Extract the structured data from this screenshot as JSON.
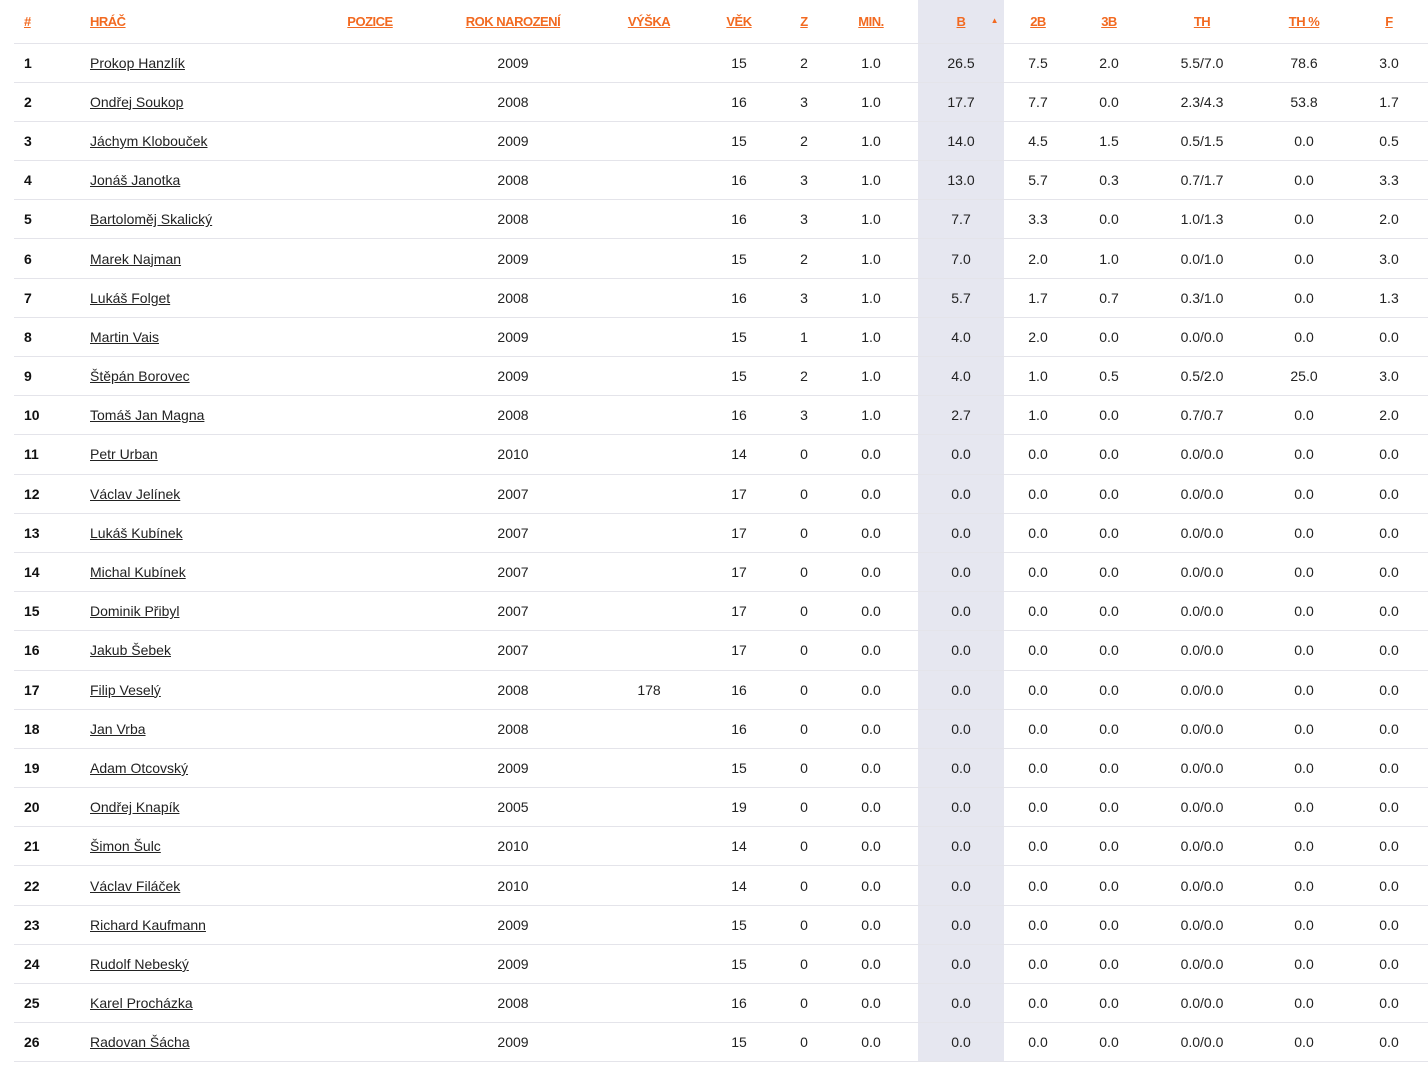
{
  "table": {
    "headers": {
      "rank": "#",
      "player": "HRÁČ",
      "position": "POZICE",
      "birth_year": "ROK NAROZENÍ",
      "height": "VÝŠKA",
      "age": "VĚK",
      "games": "Z",
      "minutes": "MIN.",
      "points": "B",
      "two_pt": "2B",
      "three_pt": "3B",
      "free_throws": "TH",
      "free_throw_pct": "TH %",
      "fouls": "F"
    },
    "sort_indicator": "▲",
    "rows": [
      {
        "rank": "1",
        "name": "Prokop Hanzlík",
        "position": "",
        "birth_year": "2009",
        "height": "",
        "age": "15",
        "games": "2",
        "minutes": "1.0",
        "points": "26.5",
        "two_pt": "7.5",
        "three_pt": "2.0",
        "free_throws": "5.5/7.0",
        "ft_pct": "78.6",
        "fouls": "3.0"
      },
      {
        "rank": "2",
        "name": "Ondřej Soukop",
        "position": "",
        "birth_year": "2008",
        "height": "",
        "age": "16",
        "games": "3",
        "minutes": "1.0",
        "points": "17.7",
        "two_pt": "7.7",
        "three_pt": "0.0",
        "free_throws": "2.3/4.3",
        "ft_pct": "53.8",
        "fouls": "1.7"
      },
      {
        "rank": "3",
        "name": "Jáchym Klobouček",
        "position": "",
        "birth_year": "2009",
        "height": "",
        "age": "15",
        "games": "2",
        "minutes": "1.0",
        "points": "14.0",
        "two_pt": "4.5",
        "three_pt": "1.5",
        "free_throws": "0.5/1.5",
        "ft_pct": "0.0",
        "fouls": "0.5"
      },
      {
        "rank": "4",
        "name": "Jonáš Janotka",
        "position": "",
        "birth_year": "2008",
        "height": "",
        "age": "16",
        "games": "3",
        "minutes": "1.0",
        "points": "13.0",
        "two_pt": "5.7",
        "three_pt": "0.3",
        "free_throws": "0.7/1.7",
        "ft_pct": "0.0",
        "fouls": "3.3"
      },
      {
        "rank": "5",
        "name": "Bartoloměj Skalický",
        "position": "",
        "birth_year": "2008",
        "height": "",
        "age": "16",
        "games": "3",
        "minutes": "1.0",
        "points": "7.7",
        "two_pt": "3.3",
        "three_pt": "0.0",
        "free_throws": "1.0/1.3",
        "ft_pct": "0.0",
        "fouls": "2.0"
      },
      {
        "rank": "6",
        "name": "Marek Najman",
        "position": "",
        "birth_year": "2009",
        "height": "",
        "age": "15",
        "games": "2",
        "minutes": "1.0",
        "points": "7.0",
        "two_pt": "2.0",
        "three_pt": "1.0",
        "free_throws": "0.0/1.0",
        "ft_pct": "0.0",
        "fouls": "3.0"
      },
      {
        "rank": "7",
        "name": "Lukáš Folget",
        "position": "",
        "birth_year": "2008",
        "height": "",
        "age": "16",
        "games": "3",
        "minutes": "1.0",
        "points": "5.7",
        "two_pt": "1.7",
        "three_pt": "0.7",
        "free_throws": "0.3/1.0",
        "ft_pct": "0.0",
        "fouls": "1.3"
      },
      {
        "rank": "8",
        "name": "Martin Vais",
        "position": "",
        "birth_year": "2009",
        "height": "",
        "age": "15",
        "games": "1",
        "minutes": "1.0",
        "points": "4.0",
        "two_pt": "2.0",
        "three_pt": "0.0",
        "free_throws": "0.0/0.0",
        "ft_pct": "0.0",
        "fouls": "0.0"
      },
      {
        "rank": "9",
        "name": "Štěpán Borovec",
        "position": "",
        "birth_year": "2009",
        "height": "",
        "age": "15",
        "games": "2",
        "minutes": "1.0",
        "points": "4.0",
        "two_pt": "1.0",
        "three_pt": "0.5",
        "free_throws": "0.5/2.0",
        "ft_pct": "25.0",
        "fouls": "3.0"
      },
      {
        "rank": "10",
        "name": "Tomáš Jan Magna",
        "position": "",
        "birth_year": "2008",
        "height": "",
        "age": "16",
        "games": "3",
        "minutes": "1.0",
        "points": "2.7",
        "two_pt": "1.0",
        "three_pt": "0.0",
        "free_throws": "0.7/0.7",
        "ft_pct": "0.0",
        "fouls": "2.0"
      },
      {
        "rank": "11",
        "name": "Petr Urban",
        "position": "",
        "birth_year": "2010",
        "height": "",
        "age": "14",
        "games": "0",
        "minutes": "0.0",
        "points": "0.0",
        "two_pt": "0.0",
        "three_pt": "0.0",
        "free_throws": "0.0/0.0",
        "ft_pct": "0.0",
        "fouls": "0.0"
      },
      {
        "rank": "12",
        "name": "Václav Jelínek",
        "position": "",
        "birth_year": "2007",
        "height": "",
        "age": "17",
        "games": "0",
        "minutes": "0.0",
        "points": "0.0",
        "two_pt": "0.0",
        "three_pt": "0.0",
        "free_throws": "0.0/0.0",
        "ft_pct": "0.0",
        "fouls": "0.0"
      },
      {
        "rank": "13",
        "name": "Lukáš Kubínek",
        "position": "",
        "birth_year": "2007",
        "height": "",
        "age": "17",
        "games": "0",
        "minutes": "0.0",
        "points": "0.0",
        "two_pt": "0.0",
        "three_pt": "0.0",
        "free_throws": "0.0/0.0",
        "ft_pct": "0.0",
        "fouls": "0.0"
      },
      {
        "rank": "14",
        "name": "Michal Kubínek",
        "position": "",
        "birth_year": "2007",
        "height": "",
        "age": "17",
        "games": "0",
        "minutes": "0.0",
        "points": "0.0",
        "two_pt": "0.0",
        "three_pt": "0.0",
        "free_throws": "0.0/0.0",
        "ft_pct": "0.0",
        "fouls": "0.0"
      },
      {
        "rank": "15",
        "name": "Dominik Přibyl",
        "position": "",
        "birth_year": "2007",
        "height": "",
        "age": "17",
        "games": "0",
        "minutes": "0.0",
        "points": "0.0",
        "two_pt": "0.0",
        "three_pt": "0.0",
        "free_throws": "0.0/0.0",
        "ft_pct": "0.0",
        "fouls": "0.0"
      },
      {
        "rank": "16",
        "name": "Jakub Šebek",
        "position": "",
        "birth_year": "2007",
        "height": "",
        "age": "17",
        "games": "0",
        "minutes": "0.0",
        "points": "0.0",
        "two_pt": "0.0",
        "three_pt": "0.0",
        "free_throws": "0.0/0.0",
        "ft_pct": "0.0",
        "fouls": "0.0"
      },
      {
        "rank": "17",
        "name": "Filip Veselý",
        "position": "",
        "birth_year": "2008",
        "height": "178",
        "age": "16",
        "games": "0",
        "minutes": "0.0",
        "points": "0.0",
        "two_pt": "0.0",
        "three_pt": "0.0",
        "free_throws": "0.0/0.0",
        "ft_pct": "0.0",
        "fouls": "0.0"
      },
      {
        "rank": "18",
        "name": "Jan Vrba",
        "position": "",
        "birth_year": "2008",
        "height": "",
        "age": "16",
        "games": "0",
        "minutes": "0.0",
        "points": "0.0",
        "two_pt": "0.0",
        "three_pt": "0.0",
        "free_throws": "0.0/0.0",
        "ft_pct": "0.0",
        "fouls": "0.0"
      },
      {
        "rank": "19",
        "name": "Adam Otcovský",
        "position": "",
        "birth_year": "2009",
        "height": "",
        "age": "15",
        "games": "0",
        "minutes": "0.0",
        "points": "0.0",
        "two_pt": "0.0",
        "three_pt": "0.0",
        "free_throws": "0.0/0.0",
        "ft_pct": "0.0",
        "fouls": "0.0"
      },
      {
        "rank": "20",
        "name": "Ondřej Knapík",
        "position": "",
        "birth_year": "2005",
        "height": "",
        "age": "19",
        "games": "0",
        "minutes": "0.0",
        "points": "0.0",
        "two_pt": "0.0",
        "three_pt": "0.0",
        "free_throws": "0.0/0.0",
        "ft_pct": "0.0",
        "fouls": "0.0"
      },
      {
        "rank": "21",
        "name": "Šimon Šulc",
        "position": "",
        "birth_year": "2010",
        "height": "",
        "age": "14",
        "games": "0",
        "minutes": "0.0",
        "points": "0.0",
        "two_pt": "0.0",
        "three_pt": "0.0",
        "free_throws": "0.0/0.0",
        "ft_pct": "0.0",
        "fouls": "0.0"
      },
      {
        "rank": "22",
        "name": "Václav Filáček",
        "position": "",
        "birth_year": "2010",
        "height": "",
        "age": "14",
        "games": "0",
        "minutes": "0.0",
        "points": "0.0",
        "two_pt": "0.0",
        "three_pt": "0.0",
        "free_throws": "0.0/0.0",
        "ft_pct": "0.0",
        "fouls": "0.0"
      },
      {
        "rank": "23",
        "name": "Richard Kaufmann",
        "position": "",
        "birth_year": "2009",
        "height": "",
        "age": "15",
        "games": "0",
        "minutes": "0.0",
        "points": "0.0",
        "two_pt": "0.0",
        "three_pt": "0.0",
        "free_throws": "0.0/0.0",
        "ft_pct": "0.0",
        "fouls": "0.0"
      },
      {
        "rank": "24",
        "name": "Rudolf Nebeský",
        "position": "",
        "birth_year": "2009",
        "height": "",
        "age": "15",
        "games": "0",
        "minutes": "0.0",
        "points": "0.0",
        "two_pt": "0.0",
        "three_pt": "0.0",
        "free_throws": "0.0/0.0",
        "ft_pct": "0.0",
        "fouls": "0.0"
      },
      {
        "rank": "25",
        "name": "Karel Procházka",
        "position": "",
        "birth_year": "2008",
        "height": "",
        "age": "16",
        "games": "0",
        "minutes": "0.0",
        "points": "0.0",
        "two_pt": "0.0",
        "three_pt": "0.0",
        "free_throws": "0.0/0.0",
        "ft_pct": "0.0",
        "fouls": "0.0"
      },
      {
        "rank": "26",
        "name": "Radovan Šácha",
        "position": "",
        "birth_year": "2009",
        "height": "",
        "age": "15",
        "games": "0",
        "minutes": "0.0",
        "points": "0.0",
        "two_pt": "0.0",
        "three_pt": "0.0",
        "free_throws": "0.0/0.0",
        "ft_pct": "0.0",
        "fouls": "0.0"
      }
    ]
  }
}
